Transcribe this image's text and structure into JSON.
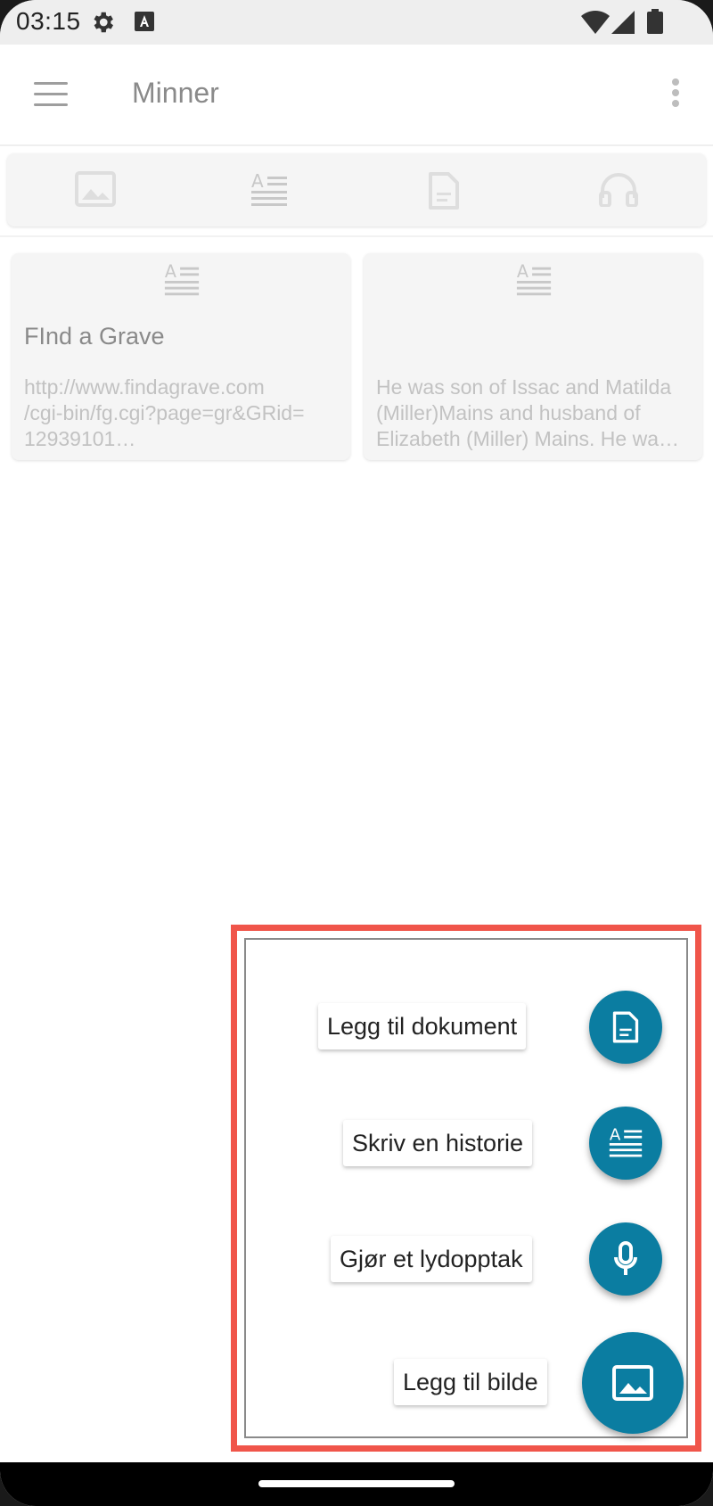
{
  "status_bar": {
    "time": "03:15",
    "icons": [
      "settings-icon",
      "accessibility-a-icon",
      "wifi-icon",
      "signal-icon",
      "battery-icon"
    ]
  },
  "toolbar": {
    "title": "Minner",
    "menu_icon": "hamburger-menu-icon",
    "more_icon": "more-vertical-icon"
  },
  "filter_tabs": [
    {
      "icon": "image-icon"
    },
    {
      "icon": "story-text-icon"
    },
    {
      "icon": "document-icon"
    },
    {
      "icon": "headphones-icon"
    }
  ],
  "cards": [
    {
      "icon": "story-text-icon",
      "title": "FInd a Grave",
      "lines": [
        "http://www.findagrave.com",
        "/cgi-bin/fg.cgi?page=gr&GRid=",
        "12939101…"
      ]
    },
    {
      "icon": "story-text-icon",
      "title": "",
      "lines": [
        "He was son of Issac and Matilda",
        "(Miller)Mains and husband of",
        "Elizabeth (Miller) Mains. He wa…"
      ]
    }
  ],
  "fab_menu": {
    "items": [
      {
        "label": "Legg til dokument",
        "icon": "document-icon"
      },
      {
        "label": "Skriv en historie",
        "icon": "story-text-icon"
      },
      {
        "label": "Gjør et lydopptak",
        "icon": "microphone-icon"
      },
      {
        "label": "Legg til bilde",
        "icon": "image-icon"
      }
    ]
  },
  "colors": {
    "fab": "#0b7da1",
    "highlight": "#f0554a"
  }
}
